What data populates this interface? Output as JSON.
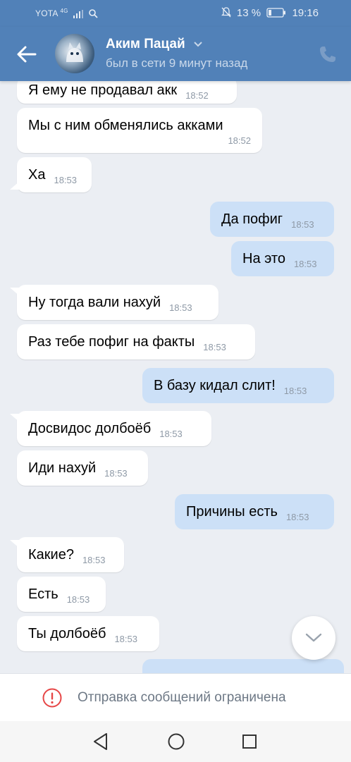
{
  "statusbar": {
    "carrier": "YOTA",
    "network": "4G",
    "battery": "13 %",
    "time": "19:16"
  },
  "header": {
    "name": "Аким Пацай",
    "status": "был в сети 9 минут назад"
  },
  "messages": [
    {
      "dir": "in",
      "text": "Я ему не продавал акк",
      "time": "18:52"
    },
    {
      "dir": "in",
      "text": "Мы с ним обменялись акками",
      "time": "18:52"
    },
    {
      "dir": "in",
      "text": "Ха",
      "time": "18:53"
    },
    {
      "dir": "out",
      "text": "Да пофиг",
      "time": "18:53"
    },
    {
      "dir": "out",
      "text": "На это",
      "time": "18:53"
    },
    {
      "dir": "in",
      "text": "Ну тогда вали нахуй",
      "time": "18:53"
    },
    {
      "dir": "in",
      "text": "Раз тебе пофиг на факты",
      "time": "18:53"
    },
    {
      "dir": "out",
      "text": "В базу кидал слит!",
      "time": "18:53"
    },
    {
      "dir": "in",
      "text": "Досвидос долбоёб",
      "time": "18:53"
    },
    {
      "dir": "in",
      "text": "Иди нахуй",
      "time": "18:53"
    },
    {
      "dir": "out",
      "text": "Причины есть",
      "time": "18:53"
    },
    {
      "dir": "in",
      "text": "Какие?",
      "time": "18:53"
    },
    {
      "dir": "in",
      "text": "Есть",
      "time": "18:53"
    },
    {
      "dir": "in",
      "text": "Ты долбоёб",
      "time": "18:53"
    }
  ],
  "restriction": {
    "text": "Отправка сообщений ограничена"
  },
  "colors": {
    "header": "#5181b8",
    "background": "#ebeef3",
    "incoming_bubble": "#ffffff",
    "outgoing_bubble": "#cce0f7",
    "warning": "#e64646"
  }
}
